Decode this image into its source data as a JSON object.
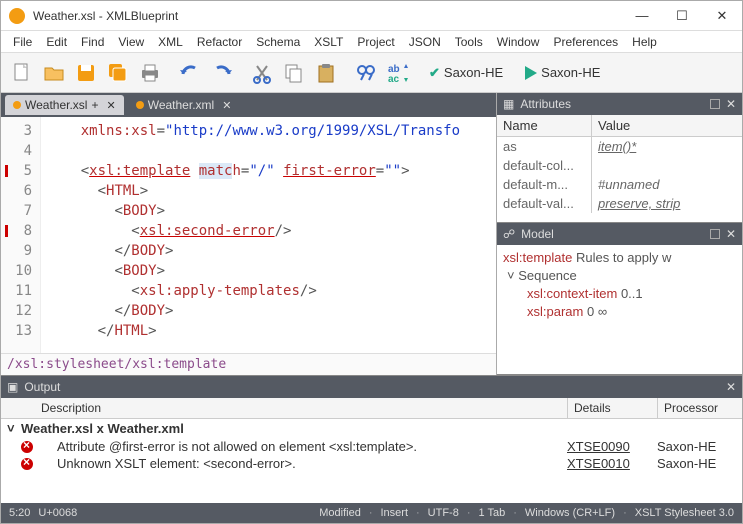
{
  "window": {
    "title": "Weather.xsl - XMLBlueprint"
  },
  "menu": [
    "File",
    "Edit",
    "Find",
    "View",
    "XML",
    "Refactor",
    "Schema",
    "XSLT",
    "Project",
    "JSON",
    "Tools",
    "Window",
    "Preferences",
    "Help"
  ],
  "toolbar": {
    "validate_label": "Saxon-HE",
    "run_label": "Saxon-HE"
  },
  "tabs": [
    {
      "label": "Weather.xsl",
      "dirty": true,
      "active": true
    },
    {
      "label": "Weather.xml",
      "dirty": false,
      "active": false
    }
  ],
  "editor": {
    "lines": [
      {
        "n": 3,
        "html": "    <span class='t-attrname'>xmlns:xsl</span><span class='t-punc'>=</span><span class='t-attrval'>\"http://www.w3.org/1999/XSL/Transfo</span>"
      },
      {
        "n": 4,
        "html": ""
      },
      {
        "n": 5,
        "html": "    <span class='t-punc'>&lt;</span><span class='t-tag u-err'>xsl:template</span> <span class='t-attrname hl'>matc</span><span class='t-attrname'>h</span><span class='t-punc'>=</span><span class='t-attrval'>\"/\"</span> <span class='t-attrname u-err'>first-error</span><span class='t-punc'>=</span><span class='t-attrval'>\"\"</span><span class='t-punc'>&gt;</span>",
        "err": true
      },
      {
        "n": 6,
        "html": "      <span class='t-punc'>&lt;</span><span class='t-tag'>HTML</span><span class='t-punc'>&gt;</span>"
      },
      {
        "n": 7,
        "html": "        <span class='t-punc'>&lt;</span><span class='t-tag'>BODY</span><span class='t-punc'>&gt;</span>"
      },
      {
        "n": 8,
        "html": "          <span class='t-punc'>&lt;</span><span class='t-tag u-err'>xsl:second-error</span><span class='t-punc'>/&gt;</span>",
        "err": true
      },
      {
        "n": 9,
        "html": "        <span class='t-punc'>&lt;/</span><span class='t-tag'>BODY</span><span class='t-punc'>&gt;</span>"
      },
      {
        "n": 10,
        "html": "        <span class='t-punc'>&lt;</span><span class='t-tag'>BODY</span><span class='t-punc'>&gt;</span>"
      },
      {
        "n": 11,
        "html": "          <span class='t-punc'>&lt;</span><span class='t-tag'>xsl:apply-templates</span><span class='t-punc'>/&gt;</span>"
      },
      {
        "n": 12,
        "html": "        <span class='t-punc'>&lt;/</span><span class='t-tag'>BODY</span><span class='t-punc'>&gt;</span>"
      },
      {
        "n": 13,
        "html": "      <span class='t-punc'>&lt;/</span><span class='t-tag'>HTML</span><span class='t-punc'>&gt;</span>"
      }
    ],
    "breadcrumb": "/xsl:stylesheet/xsl:template"
  },
  "attributes": {
    "title": "Attributes",
    "head_name": "Name",
    "head_value": "Value",
    "rows": [
      {
        "name": "as",
        "value": "item()*",
        "u": true
      },
      {
        "name": "default-col...",
        "value": ""
      },
      {
        "name": "default-m...",
        "value": "#unnamed"
      },
      {
        "name": "default-val...",
        "value": "preserve, strip",
        "u": true
      }
    ]
  },
  "model": {
    "title": "Model",
    "root_tag": "xsl:template",
    "root_desc": "Rules to apply w",
    "seq_label": "Sequence",
    "items": [
      {
        "name": "xsl:context-item",
        "card": "0..1"
      },
      {
        "name": "xsl:param",
        "card": "0  ∞"
      }
    ]
  },
  "output": {
    "title": "Output",
    "head_desc": "Description",
    "head_details": "Details",
    "head_proc": "Processor",
    "group": "Weather.xsl x Weather.xml",
    "rows": [
      {
        "desc": "Attribute @first-error is not allowed on element <xsl:template>.",
        "code": "XTSE0090",
        "proc": "Saxon-HE"
      },
      {
        "desc": "Unknown XSLT element: <second-error>.",
        "code": "XTSE0010",
        "proc": "Saxon-HE"
      }
    ]
  },
  "status": {
    "pos": "5:20",
    "codepoint": "U+0068",
    "modified": "Modified",
    "insert": "Insert",
    "enc": "UTF-8",
    "indent": "1 Tab",
    "eol": "Windows (CR+LF)",
    "doctype": "XSLT Stylesheet 3.0"
  }
}
